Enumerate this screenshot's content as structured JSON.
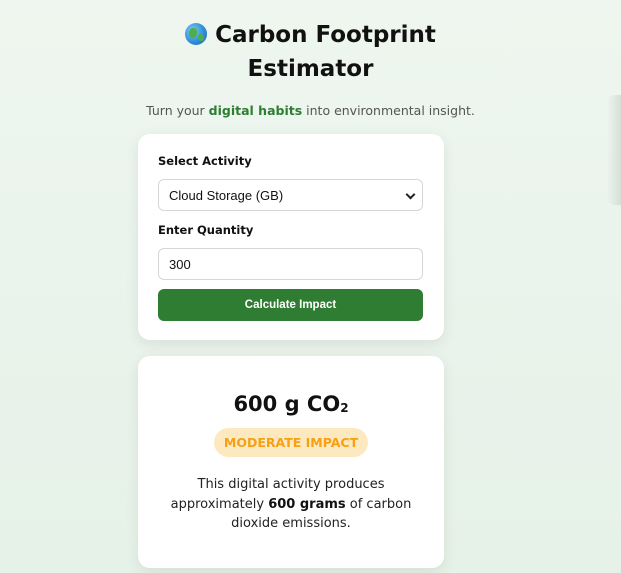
{
  "header": {
    "title": "Carbon Footprint Estimator",
    "subtitle_pre": "Turn your ",
    "subtitle_highlight": "digital habits",
    "subtitle_post": " into environmental insight."
  },
  "form": {
    "activity_label": "Select Activity",
    "activity_value": "Cloud Storage (GB)",
    "quantity_label": "Enter Quantity",
    "quantity_value": "300",
    "calculate_label": "Calculate Impact"
  },
  "result": {
    "value_text": "600 g CO",
    "value_subscript": "2",
    "impact_label": "MODERATE IMPACT",
    "desc_pre": "This digital activity produces approximately ",
    "desc_bold": "600 grams",
    "desc_post": " of carbon dioxide emissions."
  },
  "colors": {
    "accent": "#2e7d32",
    "badge_bg": "#fde9bf",
    "badge_text": "#f5a015",
    "page_bg": "#eef6ef"
  },
  "icons": {
    "title_icon": "globe-icon",
    "select_icon": "chevron-down-icon"
  }
}
